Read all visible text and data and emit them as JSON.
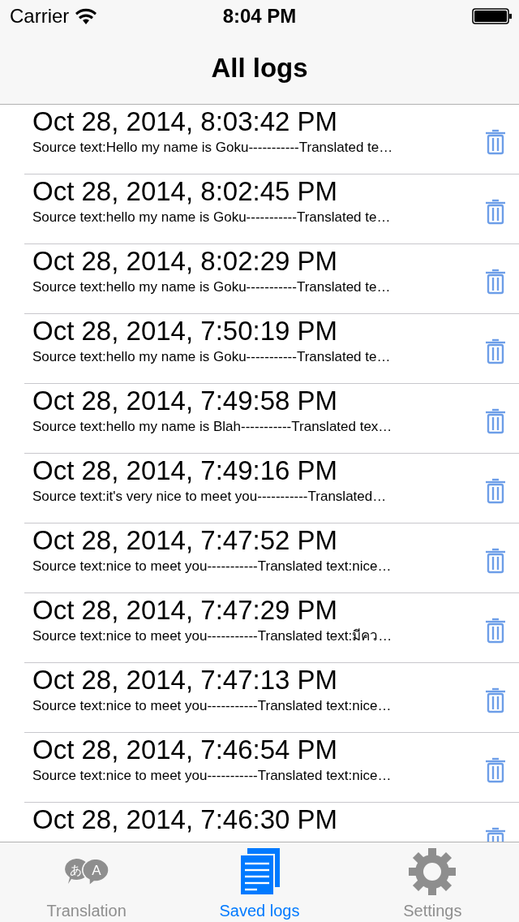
{
  "status_bar": {
    "carrier": "Carrier",
    "time": "8:04 PM"
  },
  "nav_bar": {
    "title": "All logs"
  },
  "logs": [
    {
      "date": "Oct 28, 2014, 8:03:42 PM",
      "summary": "Source text:Hello my name is Goku-----------Translated te…"
    },
    {
      "date": "Oct 28, 2014, 8:02:45 PM",
      "summary": "Source text:hello my name is Goku-----------Translated te…"
    },
    {
      "date": "Oct 28, 2014, 8:02:29 PM",
      "summary": "Source text:hello my name is Goku-----------Translated te…"
    },
    {
      "date": "Oct 28, 2014, 7:50:19 PM",
      "summary": "Source text:hello my name is Goku-----------Translated te…"
    },
    {
      "date": "Oct 28, 2014, 7:49:58 PM",
      "summary": "Source text:hello my name is Blah-----------Translated tex…"
    },
    {
      "date": "Oct 28, 2014, 7:49:16 PM",
      "summary": "Source text:it's very nice to meet you-----------Translated…"
    },
    {
      "date": "Oct 28, 2014, 7:47:52 PM",
      "summary": "Source text:nice to meet you-----------Translated text:nice…"
    },
    {
      "date": "Oct 28, 2014, 7:47:29 PM",
      "summary": "Source text:nice to meet you-----------Translated text:มีคว…"
    },
    {
      "date": "Oct 28, 2014, 7:47:13 PM",
      "summary": "Source text:nice to meet you-----------Translated text:nice…"
    },
    {
      "date": "Oct 28, 2014, 7:46:54 PM",
      "summary": "Source text:nice to meet you-----------Translated text:nice…"
    },
    {
      "date": "Oct 28, 2014, 7:46:30 PM"
    }
  ],
  "tabs": [
    {
      "kind": "translate",
      "label": "Translation",
      "selected": false,
      "glyphs": [
        "あ",
        "A"
      ]
    },
    {
      "kind": "logs",
      "label": "Saved logs",
      "selected": true
    },
    {
      "kind": "settings",
      "label": "Settings",
      "selected": false
    }
  ]
}
